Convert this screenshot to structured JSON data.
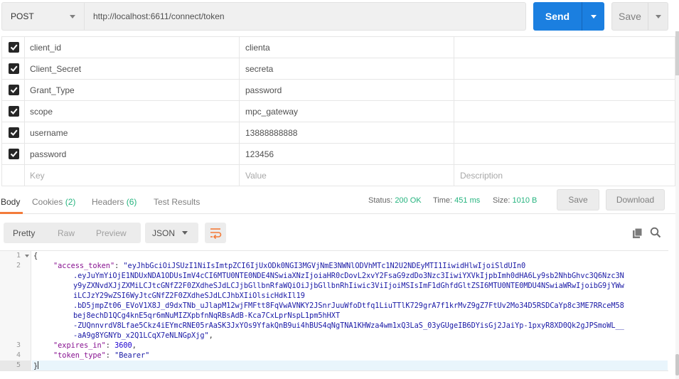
{
  "request": {
    "method": "POST",
    "url": "http://localhost:6611/connect/token",
    "send_label": "Send",
    "save_label": "Save"
  },
  "params": {
    "rows": [
      {
        "key": "client_id",
        "value": "clienta",
        "checked": true
      },
      {
        "key": "Client_Secret",
        "value": "secreta",
        "checked": true
      },
      {
        "key": "Grant_Type",
        "value": "password",
        "checked": true
      },
      {
        "key": "scope",
        "value": "mpc_gateway",
        "checked": true
      },
      {
        "key": "username",
        "value": "13888888888",
        "checked": true
      },
      {
        "key": "password",
        "value": "123456",
        "checked": true
      }
    ],
    "placeholder": {
      "key": "Key",
      "value": "Value",
      "description": "Description"
    }
  },
  "response": {
    "tabs": {
      "body": "Body",
      "cookies": "Cookies",
      "cookies_count": "(2)",
      "headers": "Headers",
      "headers_count": "(6)",
      "tests": "Test Results"
    },
    "status_label": "Status:",
    "status_value": "200 OK",
    "time_label": "Time:",
    "time_value": "451 ms",
    "size_label": "Size:",
    "size_value": "1010 B",
    "save_button": "Save",
    "download_button": "Download",
    "view_modes": {
      "pretty": "Pretty",
      "raw": "Raw",
      "preview": "Preview"
    },
    "format": "JSON",
    "body": {
      "line_numbers": [
        "1",
        "2",
        "3",
        "4",
        "5"
      ],
      "open_brace": "{",
      "close_brace": "}",
      "access_token_key": "\"access_token\"",
      "access_token_lines": [
        "\"eyJhbGciOiJSUzI1NiIsImtpZCI6IjUxODk0NGI3MGVjNmE3NWNlODVhMTc1N2U2NDEyMTI1IiwidHlwIjoiSldUIn0",
        ".eyJuYmYiOjE1NDUxNDA1ODUsImV4cCI6MTU0NTE0NDE4NSwiaXNzIjoiaHR0cDovL2xvY2FsaG9zdDo3Nzc3IiwiYXVkIjpbImh0dHA6Ly9sb2NhbGhvc3Q6Nzc3N",
        "y9yZXNvdXJjZXMiLCJtcGNfZ2F0ZXdheSJdLCJjbGllbnRfaWQiOiJjbGllbnRhIiwic3ViIjoiMSIsImF1dGhfdGltZSI6MTU0NTE0MDU4NSwiaWRwIjoibG9jYWw",
        "iLCJzY29wZSI6WyJtcGNfZ2F0ZXdheSJdLCJhbXIiOlsicHdkIl19",
        ".bD5jmpZt06_EVoV1X8J_d9dxTNb_uJlapM12wjFMFtt8FqVwAVNKY2JSnrJuuWfoDtfq1LiuTTlK729grA7f1krMvZ9gZ7FtUv2Mo34D5RSDCaYp8c3ME7RRceM58",
        "bej8echD1QCg4knE5qr6mNuMIZXpbfnNqRBsAdB-Kca7CxLprNspL1pm5hHXT",
        "-ZUQnnvrdV8Lfae5Ckz4iEYmcRNE05rAaSK3JxYOs9YfakQnB9ui4hBUS4qNgTNA1KHWza4wm1xQ3LaS_03yGUgeIB6DYisGj2JaiYp-1pxyR8XD0Qk2gJPSmoWL__",
        "-aA9g8YGNYb_x2Q1LCqX7eNLNGpXjg\""
      ],
      "expires_in_key": "\"expires_in\"",
      "expires_in_value": "3600",
      "token_type_key": "\"token_type\"",
      "token_type_value": "\"Bearer\""
    }
  },
  "colors": {
    "accent": "#1b7fe0",
    "status_ok": "#26b47f",
    "active_tab_underline": "#f37b3a"
  },
  "icons": {
    "method_dropdown": "chevron-down-icon",
    "checkbox": "check-icon",
    "wrap": "wrap-lines-icon",
    "copy": "copy-icon",
    "search": "search-icon"
  }
}
